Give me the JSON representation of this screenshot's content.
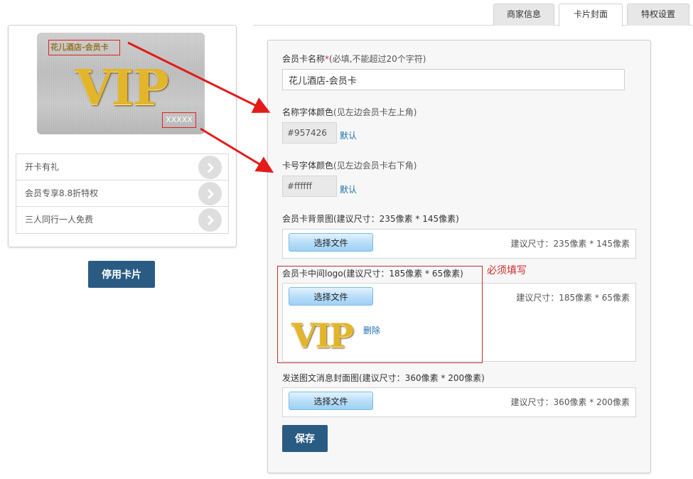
{
  "tabs": [
    {
      "label": "商家信息",
      "active": false
    },
    {
      "label": "卡片封面",
      "active": true
    },
    {
      "label": "特权设置",
      "active": false
    }
  ],
  "card_preview": {
    "name": "花儿酒店-会员卡",
    "number_placeholder": "XXXXX",
    "logo_text": "VIP",
    "perks": [
      "开卡有礼",
      "会员专享8.8折特权",
      "三人同行一人免费"
    ],
    "disable_button": "停用卡片"
  },
  "form": {
    "card_name": {
      "label": "会员卡名称",
      "required_mark": "*",
      "hint": "(必填,不能超过20个字符)",
      "value": "花儿酒店-会员卡"
    },
    "name_color": {
      "label": "名称字体颜色",
      "hint": "(见左边会员卡左上角)",
      "value": "#957426",
      "default_link": "默认"
    },
    "number_color": {
      "label": "卡号字体颜色",
      "hint": "(见左边会员卡右下角)",
      "value": "#ffffff",
      "default_link": "默认"
    },
    "background_image": {
      "label": "会员卡背景图(建议尺寸：235像素 * 145像素)",
      "button": "选择文件",
      "size_hint": "建议尺寸：235像素 * 145像素"
    },
    "middle_logo": {
      "label": "会员卡中间logo(建议尺寸：185像素 * 65像素)",
      "button": "选择文件",
      "size_hint": "建议尺寸：185像素 * 65像素",
      "preview_text": "VIP",
      "delete_link": "删除"
    },
    "cover_image": {
      "label": "发送图文消息封面图(建议尺寸：360像素 * 200像素)",
      "button": "选择文件",
      "size_hint": "建议尺寸：360像素 * 200像素"
    },
    "save_button": "保存"
  },
  "annotation": {
    "required_note": "必须填写",
    "color": "#d2262a"
  },
  "colors": {
    "primary_button": "#2a5b83",
    "link": "#1a6fb0",
    "card_name_color": "#957426",
    "vip_gold": "#e2b52a"
  },
  "icons": {
    "perk_arrow": "chevron-right-icon",
    "annotation_arrow": "red-arrow-icon"
  }
}
